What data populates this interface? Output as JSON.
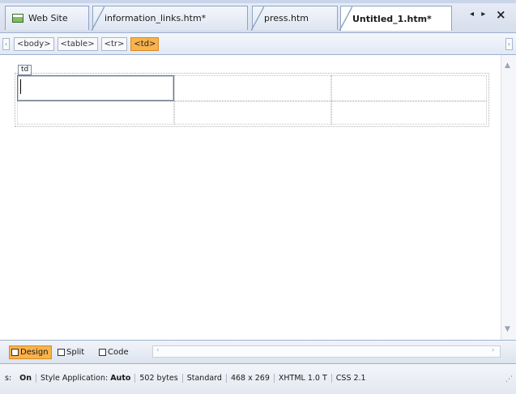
{
  "tabs": [
    {
      "label": "Web Site",
      "icon": "site-icon",
      "active": false
    },
    {
      "label": "information_links.htm*",
      "active": false
    },
    {
      "label": "press.htm",
      "active": false
    },
    {
      "label": "Untitled_1.htm*",
      "active": true
    }
  ],
  "tab_controls": {
    "arrows": "◂ ▸",
    "close": "×"
  },
  "tag_selector": {
    "tags": [
      "<body>",
      "<table>",
      "<tr>",
      "<td>"
    ],
    "selected": "<td>"
  },
  "document": {
    "cell_label": "td"
  },
  "view_bar": {
    "design_label": "Design",
    "split_label": "Split",
    "code_label": "Code",
    "active": "Design"
  },
  "status_bar": {
    "prefix": "s:",
    "mode": "On",
    "style_application_label": "Style Application:",
    "style_application_value": "Auto",
    "file_size": "502 bytes",
    "doc_type": "Standard",
    "dimensions": "468 x 269",
    "doctype_version": "XHTML 1.0 T",
    "css_version": "CSS 2.1"
  },
  "colors": {
    "selected_tag": "#f9b24c",
    "tab_border": "#8ea3c6"
  }
}
